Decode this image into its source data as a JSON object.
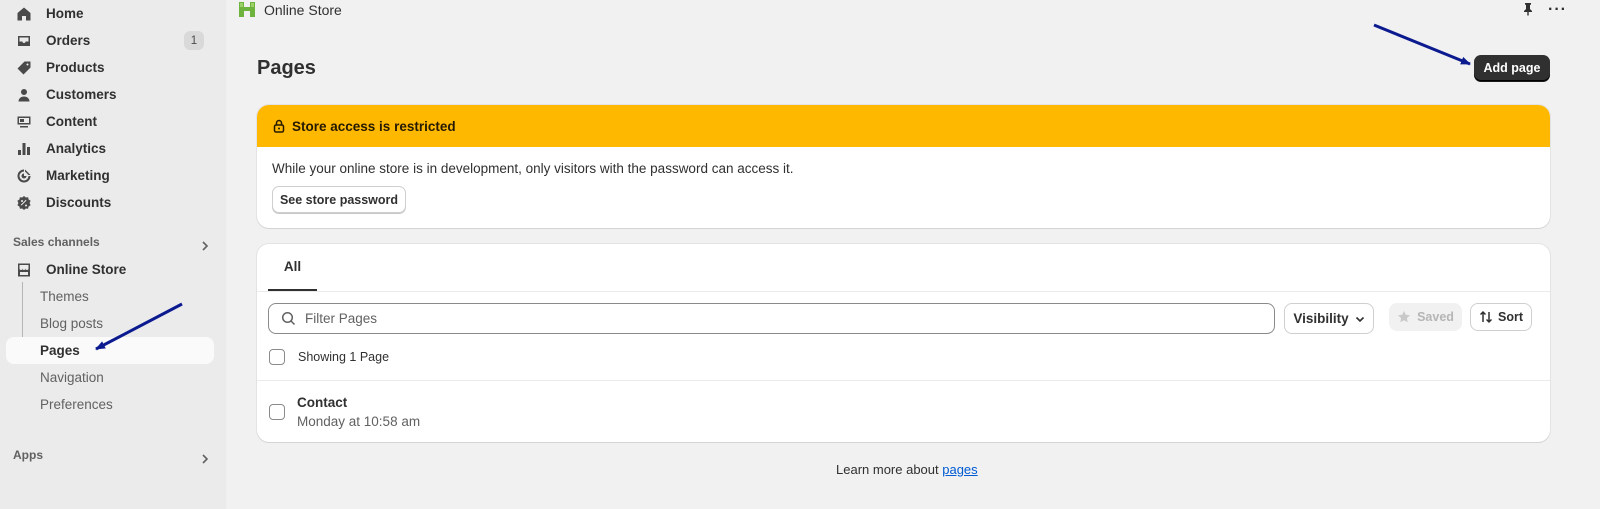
{
  "sidebar": {
    "items": [
      {
        "label": "Home",
        "icon": "home-icon"
      },
      {
        "label": "Orders",
        "icon": "inbox-icon",
        "badge": "1"
      },
      {
        "label": "Products",
        "icon": "tag-icon"
      },
      {
        "label": "Customers",
        "icon": "person-icon"
      },
      {
        "label": "Content",
        "icon": "content-icon"
      },
      {
        "label": "Analytics",
        "icon": "bar-chart-icon"
      },
      {
        "label": "Marketing",
        "icon": "target-icon"
      },
      {
        "label": "Discounts",
        "icon": "discount-icon"
      }
    ],
    "sales_channels_label": "Sales channels",
    "online_store": {
      "label": "Online Store",
      "sub_items": [
        "Themes",
        "Blog posts",
        "Pages",
        "Navigation",
        "Preferences"
      ],
      "active": "Pages"
    },
    "apps_label": "Apps"
  },
  "topbar": {
    "title": "Online Store"
  },
  "page": {
    "title": "Pages",
    "add_button": "Add page"
  },
  "banner": {
    "title": "Store access is restricted",
    "text": "While your online store is in development, only visitors with the password can access it.",
    "button": "See store password",
    "color": "#ffb800"
  },
  "pages_card": {
    "tab": "All",
    "search_placeholder": "Filter Pages",
    "visibility_label": "Visibility",
    "saved_label": "Saved",
    "sort_label": "Sort",
    "showing": "Showing 1 Page",
    "rows": [
      {
        "title": "Contact",
        "subtitle": "Monday at 10:58 am"
      }
    ]
  },
  "footer": {
    "text": "Learn more about ",
    "link": "pages"
  }
}
